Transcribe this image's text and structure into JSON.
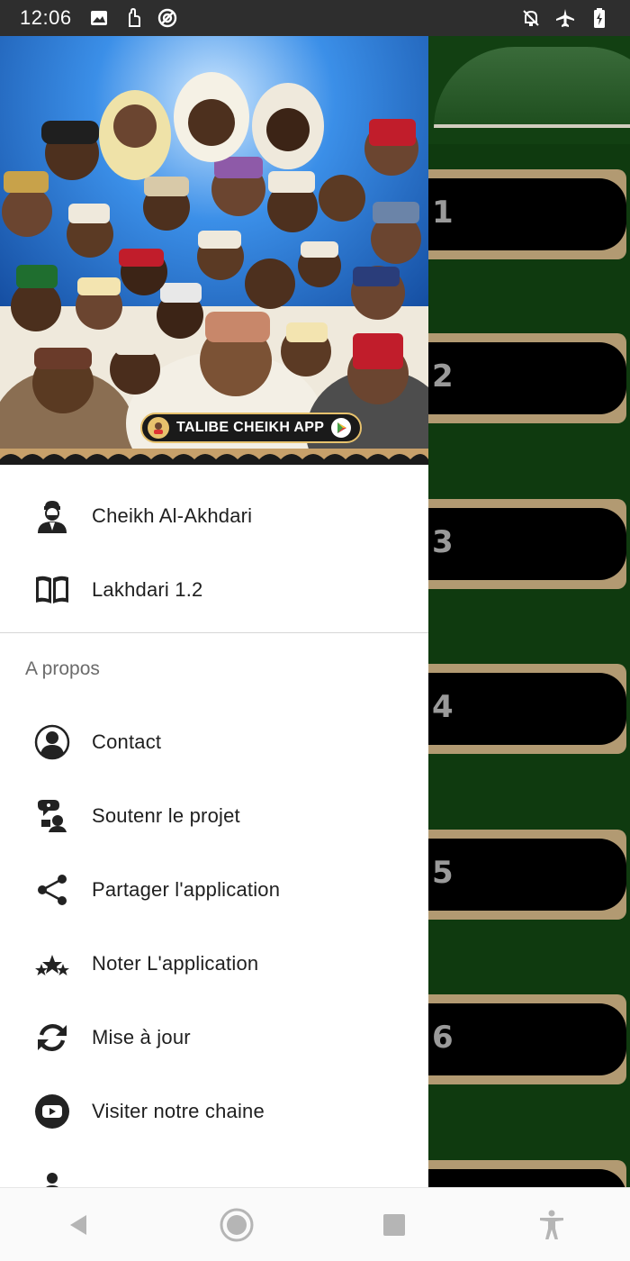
{
  "status_bar": {
    "time": "12:06",
    "left_icons": [
      "image-icon",
      "hand-icon",
      "sync-disabled-icon"
    ],
    "right_icons": [
      "notifications-off-icon",
      "airplane-icon",
      "battery-charging-icon"
    ]
  },
  "drawer": {
    "header_badge": "TALIBE CHEIKH APP",
    "items": [
      {
        "label": "Cheikh Al-Akhdari",
        "icon": "scholar-icon"
      },
      {
        "label": "Lakhdari 1.2",
        "icon": "book-icon"
      }
    ],
    "section_title": "A propos",
    "about_items": [
      {
        "label": "Contact",
        "icon": "person-circle-icon"
      },
      {
        "label": "Soutenr le projet",
        "icon": "support-icon"
      },
      {
        "label": "Partager l'application",
        "icon": "share-icon"
      },
      {
        "label": "Noter L'application",
        "icon": "stars-icon"
      },
      {
        "label": "Mise à jour",
        "icon": "refresh-icon"
      },
      {
        "label": "Visiter notre chaine",
        "icon": "youtube-icon"
      }
    ]
  },
  "background": {
    "row_numbers": [
      "1",
      "2",
      "3",
      "4",
      "5",
      "6"
    ]
  },
  "nav_bar": {
    "buttons": [
      "back-icon",
      "home-icon",
      "recents-icon",
      "accessibility-icon"
    ]
  },
  "colors": {
    "drawer_bg": "#ffffff",
    "content_bg": "#0f3a0f",
    "status_bar": "#2e2e2e",
    "badge_border": "#e7c26d"
  }
}
